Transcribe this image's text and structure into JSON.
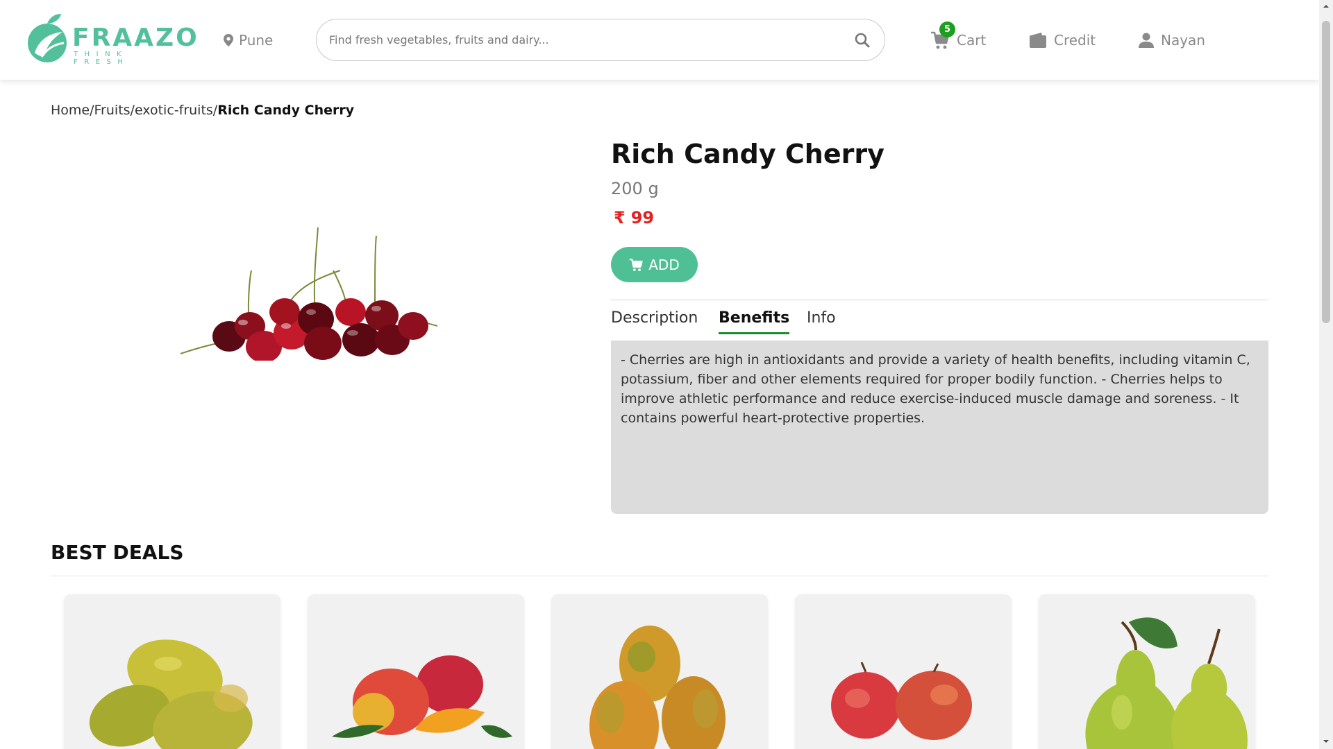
{
  "brand": {
    "name": "FRAAZO",
    "tagline": "THINK FRESH",
    "accent": "#52c19b"
  },
  "header": {
    "location": "Pune",
    "search": {
      "placeholder": "Find fresh vegetables, fruits and dairy..."
    },
    "cart": {
      "label": "Cart",
      "count": "5"
    },
    "credit": {
      "label": "Credit"
    },
    "user": {
      "label": "Nayan"
    }
  },
  "breadcrumb": {
    "items": [
      "Home",
      "Fruits",
      "exotic-fruits"
    ],
    "separator": "/",
    "current": "Rich Candy Cherry"
  },
  "product": {
    "title": "Rich Candy Cherry",
    "weight": "200 g",
    "currency": "₹",
    "price": "99",
    "add_label": "ADD",
    "price_color": "#e32222",
    "button_color": "#4fc095"
  },
  "tabs": {
    "items": [
      "Description",
      "Benefits",
      "Info"
    ],
    "active": "Benefits",
    "content": "- Cherries are high in antioxidants and provide a variety of health benefits, including vitamin C, potassium, fiber and other elements required for proper bodily function. - Cherries helps to improve athletic performance and reduce exercise-induced muscle damage and soreness. - It contains powerful heart-protective properties."
  },
  "best_deals": {
    "title": "BEST DEALS",
    "cards": [
      {
        "image": "mango-image"
      },
      {
        "image": "mango-slice-image"
      },
      {
        "image": "mango-pile-image"
      },
      {
        "image": "apples-image"
      },
      {
        "image": "pears-image"
      }
    ]
  }
}
